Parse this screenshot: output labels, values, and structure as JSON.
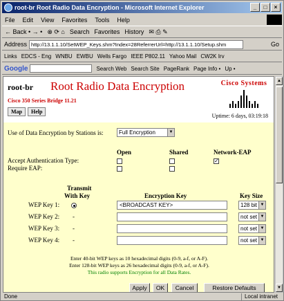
{
  "window": {
    "title": "root-br Root Radio Data Encryption - Microsoft Internet Explorer"
  },
  "menu": [
    "File",
    "Edit",
    "View",
    "Favorites",
    "Tools",
    "Help"
  ],
  "toolbar": [
    "← Back • → •",
    "Search",
    "Favorites",
    "History"
  ],
  "address": {
    "label": "Address",
    "url": "http://13.1.1.10/SetWEP_Keys.shm?Index=28ReferrerUrl=http://13.1.1.10/Setup.shm",
    "go": "Go"
  },
  "links": {
    "label": "Links",
    "items": [
      "EDCS - Eng",
      "WNBU",
      "EWBU",
      "Wells Fargo",
      "IEEE P802.11",
      "Yahoo Mail",
      "CW2K Irv"
    ]
  },
  "google": {
    "label": "Google",
    "items": [
      "Search Web",
      "Search Site",
      "PageRank",
      "Page Info •",
      "Up •"
    ]
  },
  "page": {
    "router": "root-br",
    "title": "Root Radio Data Encryption",
    "series": "Cisco 350 Series Bridge 11.21",
    "cisco": "Cisco Systems",
    "map": "Map",
    "help": "Help",
    "uptime": "Uptime: 6 days, 03:19:18",
    "use_label": "Use of Data Encryption by Stations is:",
    "use_value": "Full Encryption",
    "col_open": "Open",
    "col_shared": "Shared",
    "col_neap": "Network-EAP",
    "accept_auth": "Accept Authentication Type:",
    "require_eap": "Require EAP:",
    "transmit_head": "Transmit",
    "with_key": "With Key",
    "enc_key": "Encryption Key",
    "key_size": "Key Size",
    "keys": [
      {
        "label": "WEP Key 1:",
        "transmit": "selected",
        "key": "<BROADCAST KEY>",
        "size": "128 bit"
      },
      {
        "label": "WEP Key 2:",
        "transmit": "-",
        "key": "",
        "size": "not set"
      },
      {
        "label": "WEP Key 3:",
        "transmit": "-",
        "key": "",
        "size": "not set"
      },
      {
        "label": "WEP Key 4:",
        "transmit": "-",
        "key": "",
        "size": "not set"
      }
    ],
    "note1": "Enter 40-bit WEP keys as 10 hexadecimal digits (0-9, a-f, or A-F).",
    "note2": "Enter 128-bit WEP keys as 26 hexadecimal digits (0-9, a-f, or A-F).",
    "note3": "This radio supports Encryption for all Data Rates.",
    "apply": "Apply",
    "ok": "OK",
    "cancel": "Cancel",
    "restore": "Restore Defaults"
  },
  "status": {
    "left": "Done",
    "right": "Local intranet"
  },
  "colors": {
    "title_red": "#cc0000",
    "panel_yellow": "#ffffcc",
    "note_green": "#008000"
  }
}
